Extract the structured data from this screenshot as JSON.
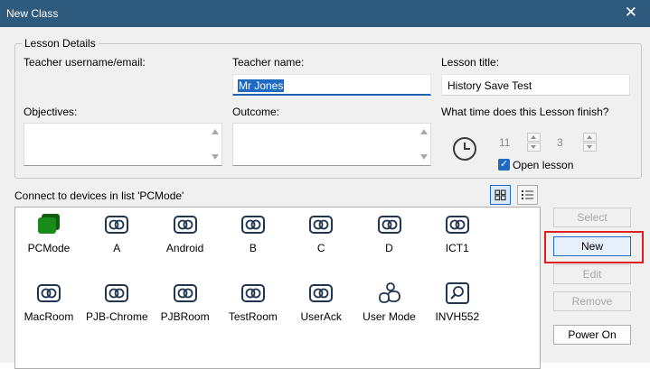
{
  "window": {
    "title": "New Class",
    "close_glyph": "✕"
  },
  "lesson_details": {
    "group_label": "Lesson Details",
    "teacher_username_label": "Teacher username/email:",
    "teacher_name_label": "Teacher name:",
    "teacher_name_value": "Mr Jones",
    "lesson_title_label": "Lesson title:",
    "lesson_title_value": "History Save Test",
    "objectives_label": "Objectives:",
    "outcome_label": "Outcome:",
    "finish_time_label": "What time does this Lesson finish?",
    "finish_hour": "11",
    "finish_minute": "3",
    "open_lesson_label": "Open lesson",
    "open_lesson_checked": true
  },
  "devices_section": {
    "label": "Connect to devices in list 'PCMode'",
    "view_icons": [
      "grid-view-icon",
      "list-view-icon"
    ],
    "items": [
      {
        "name": "PCMode",
        "icon": "pc-mode-icon"
      },
      {
        "name": "A",
        "icon": "device-group-icon"
      },
      {
        "name": "Android",
        "icon": "device-group-icon"
      },
      {
        "name": "B",
        "icon": "device-group-icon"
      },
      {
        "name": "C",
        "icon": "device-group-icon"
      },
      {
        "name": "D",
        "icon": "device-group-icon"
      },
      {
        "name": "ICT1",
        "icon": "device-group-icon"
      },
      {
        "name": "MacRoom",
        "icon": "device-group-icon"
      },
      {
        "name": "PJB-Chrome",
        "icon": "device-group-icon"
      },
      {
        "name": "PJBRoom",
        "icon": "device-group-icon"
      },
      {
        "name": "TestRoom",
        "icon": "device-group-icon"
      },
      {
        "name": "UserAck",
        "icon": "device-group-icon"
      },
      {
        "name": "User Mode",
        "icon": "user-mode-icon"
      },
      {
        "name": "INVH552",
        "icon": "search-device-icon"
      }
    ]
  },
  "actions": {
    "select": "Select",
    "new": "New",
    "edit": "Edit",
    "remove": "Remove",
    "power_on": "Power On"
  },
  "colors": {
    "titlebar": "#2e5a7e",
    "accent": "#1e6ac2",
    "highlight": "#e02020",
    "device_icon": "#1f3550",
    "pc_mode_icon": "#1a8a1a"
  }
}
